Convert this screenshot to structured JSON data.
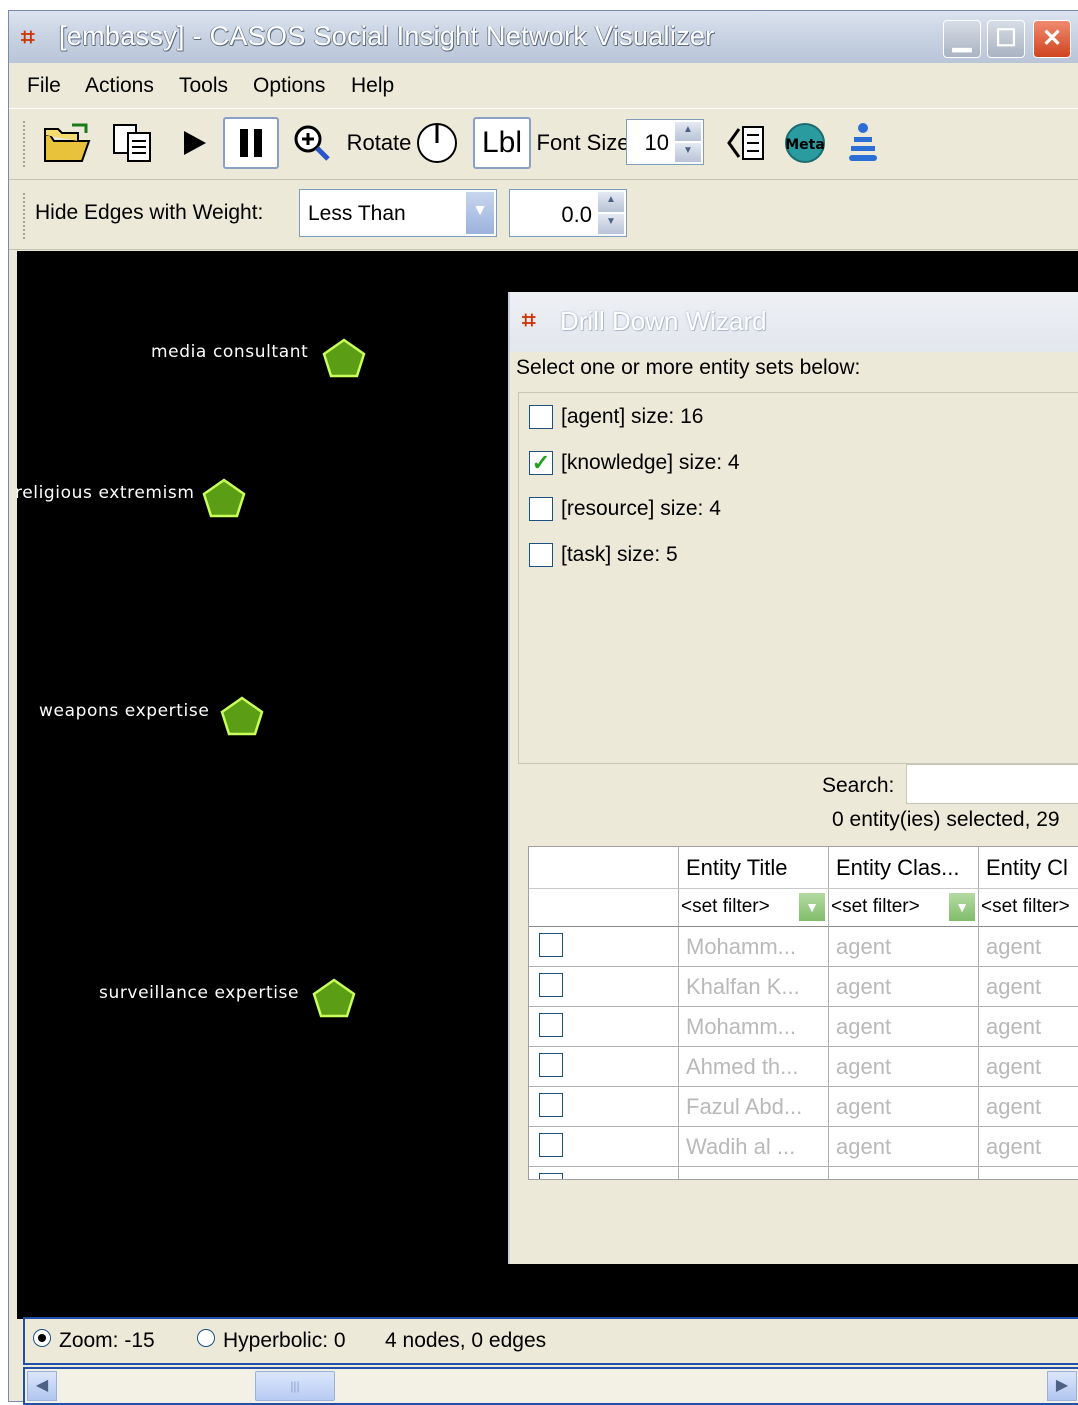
{
  "window": {
    "title": "[embassy] - CASOS Social Insight Network Visualizer"
  },
  "menu": [
    "File",
    "Actions",
    "Tools",
    "Options",
    "Help"
  ],
  "toolbar": {
    "rotate_label": "Rotate",
    "lbl_label": "Lbl",
    "font_size_label": "Font Size",
    "font_size_value": "10",
    "meta_label": "Meta"
  },
  "filter": {
    "label": "Hide Edges with Weight:",
    "operator": "Less Than",
    "weight_value": "0.0"
  },
  "nodes": [
    {
      "label": "media consultant"
    },
    {
      "label": "religious extremism"
    },
    {
      "label": "weapons expertise"
    },
    {
      "label": "surveillance expertise"
    }
  ],
  "status": {
    "zoom_label": "Zoom: -15",
    "hyperbolic_label": "Hyperbolic: 0",
    "summary": "4 nodes, 0 edges"
  },
  "dialog": {
    "title": "Drill Down Wizard",
    "prompt": "Select one or more entity sets below:",
    "entity_sets": [
      {
        "label": "[agent] size: 16",
        "checked": false
      },
      {
        "label": "[knowledge] size: 4",
        "checked": true
      },
      {
        "label": "[resource] size: 4",
        "checked": false
      },
      {
        "label": "[task] size: 5",
        "checked": false
      }
    ],
    "search_label": "Search:",
    "search_value": "",
    "selection_summary": "0 entity(ies) selected, 29",
    "table": {
      "headers": [
        "Entity Title",
        "Entity Clas...",
        "Entity Cl"
      ],
      "filter_placeholder": "<set filter>",
      "rows": [
        [
          "Mohamm...",
          "agent",
          "agent"
        ],
        [
          "Khalfan K...",
          "agent",
          "agent"
        ],
        [
          "Mohamm...",
          "agent",
          "agent"
        ],
        [
          "Ahmed th...",
          "agent",
          "agent"
        ],
        [
          "Fazul Abd...",
          "agent",
          "agent"
        ],
        [
          "Wadih al ...",
          "agent",
          "agent"
        ]
      ]
    }
  },
  "colors": {
    "canvas_bg": "#000000",
    "node_fill": "#5b9e16",
    "node_stroke": "#c8ff5a",
    "check_mark": "#21a121"
  }
}
